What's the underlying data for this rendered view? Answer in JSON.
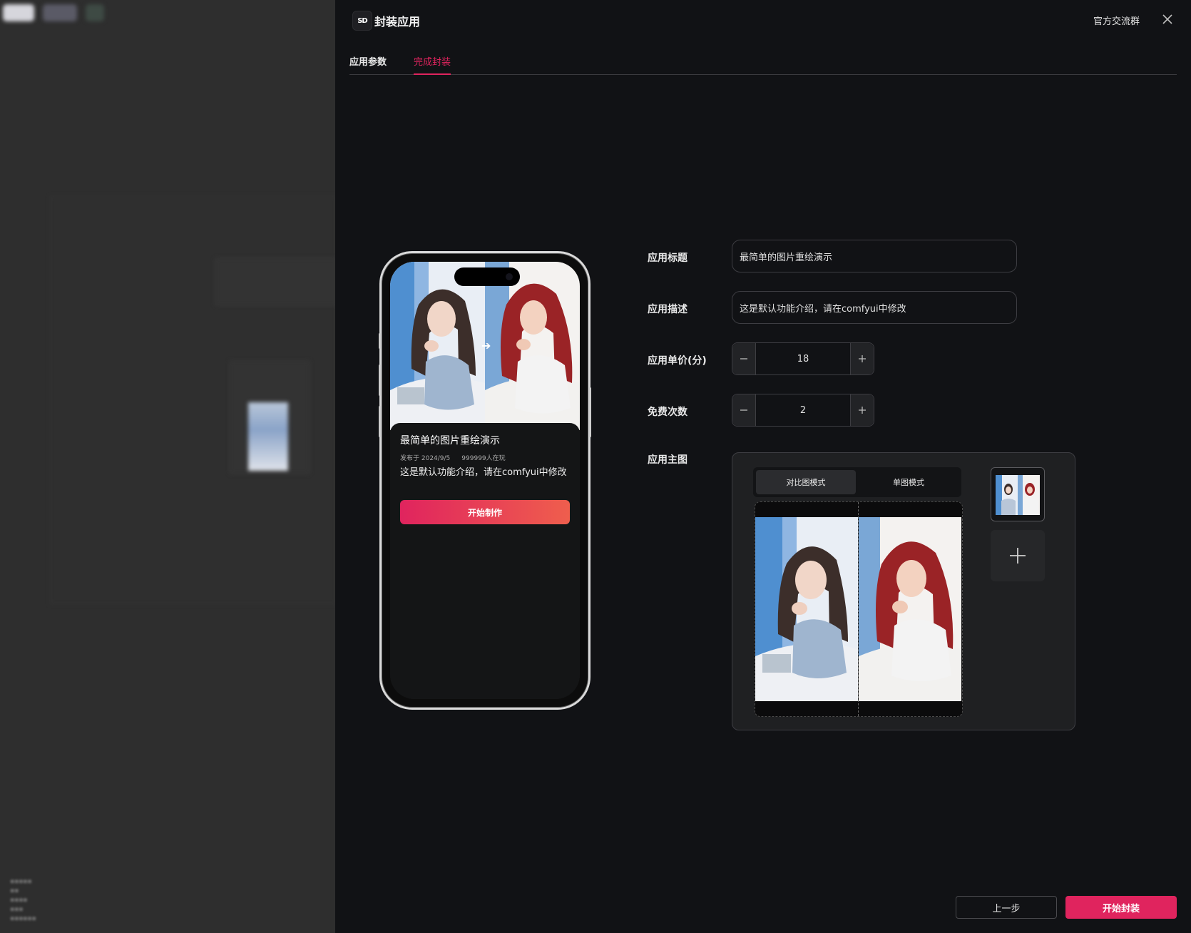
{
  "header": {
    "logo_text": "SD",
    "title": "封装应用",
    "community_link": "官方交流群",
    "close_icon": "close-icon"
  },
  "tabs": [
    {
      "label": "应用参数",
      "active": false
    },
    {
      "label": "完成封装",
      "active": true
    }
  ],
  "preview": {
    "title": "最简单的图片重绘演示",
    "published": "发布于 2024/9/5",
    "players": "999999人在玩",
    "description": "这是默认功能介绍，请在comfyui中修改",
    "start_button": "开始制作",
    "arrow_icon": "arrow-right-icon"
  },
  "form": {
    "title_label": "应用标题",
    "title_value": "最简单的图片重绘演示",
    "desc_label": "应用描述",
    "desc_value": "这是默认功能介绍，请在comfyui中修改",
    "price_label": "应用单价(分)",
    "price_value": "18",
    "free_label": "免费次数",
    "free_value": "2",
    "main_image_label": "应用主图",
    "modes": [
      {
        "label": "对比图模式",
        "active": true
      },
      {
        "label": "单图模式",
        "active": false
      }
    ]
  },
  "footer": {
    "prev_button": "上一步",
    "submit_button": "开始封装"
  },
  "colors": {
    "accent": "#e0245e",
    "drawer_bg": "#111215",
    "overlay_bg": "#2b2b2b"
  }
}
